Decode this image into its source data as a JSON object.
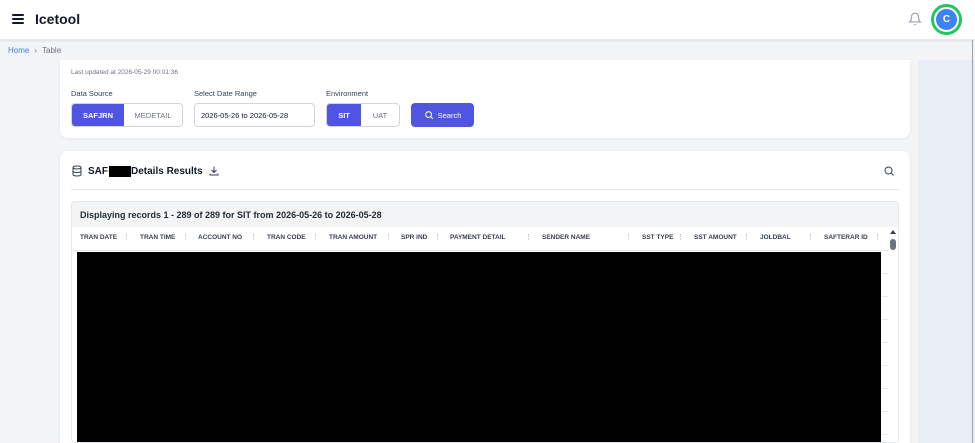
{
  "header": {
    "app_title": "Icetool",
    "avatar_initial": "C",
    "menu_icon": "hamburger-menu-icon",
    "notification_icon": "bell-icon"
  },
  "breadcrumb": {
    "home": "Home",
    "separator": "›",
    "current": "Table"
  },
  "filters": {
    "last_updated": "Last updated at 2026-05-29 00:01:36",
    "data_source": {
      "label": "Data Source",
      "options": [
        "SAFJRN",
        "MEDETAIL"
      ],
      "selected": "SAFJRN"
    },
    "date_range": {
      "label": "Select Date Range",
      "value": "2026-05-26 to 2026-05-28"
    },
    "environment": {
      "label": "Environment",
      "options": [
        "SIT",
        "UAT"
      ],
      "selected": "SIT"
    },
    "search_button": "Search"
  },
  "results": {
    "title_prefix": "SAF",
    "title_suffix": "Details Results",
    "caption": "Displaying records 1 - 289 of 289 for SIT from 2026-05-26 to 2026-05-28",
    "columns": [
      "TRAN DATE",
      "TRAN TIME",
      "ACCOUNT NO",
      "TRAN CODE",
      "TRAN AMOUNT",
      "SPR IND",
      "PAYMENT DETAIL",
      "SENDER NAME",
      "SST TYPE",
      "SST AMOUNT",
      "JOLDBAL",
      "SAFTERAR ID"
    ],
    "sort_glyph": "⋮"
  },
  "colors": {
    "accent": "#4f55e0",
    "link": "#3b82f6",
    "avatar_ring": "#22c55e",
    "avatar_fill": "#3b82f6"
  }
}
